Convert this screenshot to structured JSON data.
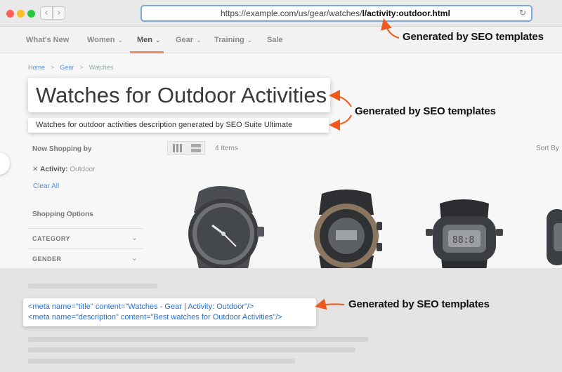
{
  "browser": {
    "back": "‹",
    "forward": "›",
    "url_prefix": "https://example.com/us/gear/watches/",
    "url_highlight": "l/activity:outdoor.html",
    "reload": "↻"
  },
  "nav": {
    "items": [
      {
        "label": "What's New",
        "has_chevron": false
      },
      {
        "label": "Women",
        "chevron": "⌄"
      },
      {
        "label": "Men",
        "chevron": "⌄",
        "active": true
      },
      {
        "label": "Gear",
        "chevron": "⌄"
      },
      {
        "label": "Training",
        "chevron": "⌄"
      },
      {
        "label": "Sale",
        "has_chevron": false
      }
    ],
    "active_underline_color": "#f08a5d"
  },
  "breadcrumb": {
    "home": "Home",
    "gear": "Gear",
    "current": "Watches",
    "separator": ">"
  },
  "page": {
    "title": "Watches for Outdoor Activities",
    "description": "Watches for outdoor activities description generated by SEO Suite Ultimate"
  },
  "sidebar": {
    "now_shopping_by": "Now Shopping by",
    "remove_icon": "✕",
    "filter_name": "Activity:",
    "filter_value": "Outdoor",
    "clear_all": "Clear All",
    "shopping_options": "Shopping Options",
    "options": [
      {
        "label": "CATEGORY",
        "chevron": "⌄"
      },
      {
        "label": "GENDER",
        "chevron": "⌄"
      }
    ]
  },
  "toolbar": {
    "items_count": "4 Items",
    "sort_by": "Sort By"
  },
  "meta": {
    "title_tag": "<meta name=\"title\" content=\"Watches - Gear | Activity: Outdoor\"/>",
    "description_tag": "<meta name=\"description\" content=\"Best watches for Outdoor Activities\"/>"
  },
  "annotations": {
    "url": "Generated by SEO templates",
    "heading": "Generated by SEO templates",
    "meta": "Generated by SEO templates",
    "arrow_color": "#ee5a1e"
  }
}
